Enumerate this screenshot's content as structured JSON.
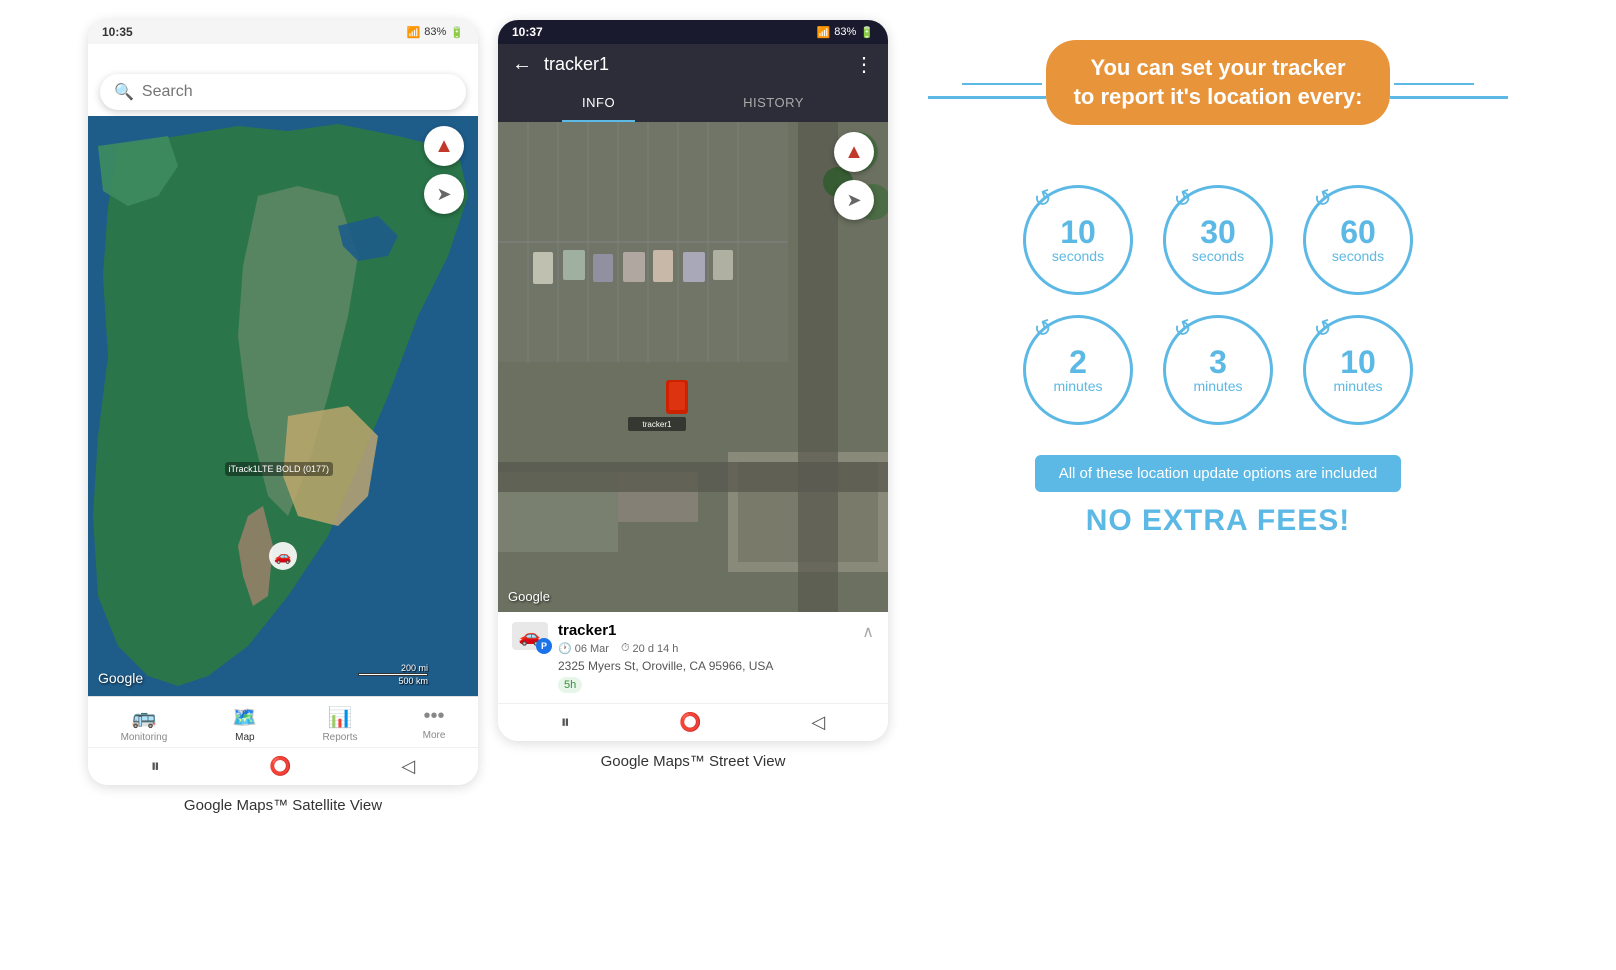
{
  "phone1": {
    "status": {
      "time": "10:35",
      "signal": "▲▲▲",
      "battery": "83%"
    },
    "search": {
      "placeholder": "Search"
    },
    "map": {
      "label": "Google",
      "scale_200mi": "200 mi",
      "scale_500km": "500 km",
      "tracker_label": "iTrack1LTE BOLD (0177)"
    },
    "nav": {
      "items": [
        {
          "icon": "🚌",
          "label": "Monitoring",
          "active": false
        },
        {
          "icon": "🗺",
          "label": "Map",
          "active": true
        },
        {
          "icon": "📊",
          "label": "Reports",
          "active": false
        },
        {
          "icon": "•••",
          "label": "More",
          "active": false
        }
      ]
    },
    "caption": "Google Maps™ Satellite View"
  },
  "phone2": {
    "status": {
      "time": "10:37",
      "signal": "▲▲▲",
      "battery": "83%"
    },
    "header": {
      "title": "tracker1",
      "back_label": "←",
      "more_label": "⋮"
    },
    "tabs": [
      {
        "label": "INFO",
        "active": true
      },
      {
        "label": "HISTORY",
        "active": false
      }
    ],
    "map": {
      "google_label": "Google",
      "tracker_label": "tracker1"
    },
    "tracker_info": {
      "name": "tracker1",
      "date": "06 Mar",
      "duration": "20 d 14 h",
      "address": "2325 Myers St, Oroville, CA 95966, USA",
      "time_badge": "5h"
    },
    "caption": "Google Maps™ Street View"
  },
  "infographic": {
    "title": "You can set your tracker\nto report it's location every:",
    "circles": [
      {
        "number": "10",
        "unit": "seconds"
      },
      {
        "number": "30",
        "unit": "seconds"
      },
      {
        "number": "60",
        "unit": "seconds"
      },
      {
        "number": "2",
        "unit": "minutes"
      },
      {
        "number": "3",
        "unit": "minutes"
      },
      {
        "number": "10",
        "unit": "minutes"
      }
    ],
    "included_text": "All of these location update options are included",
    "no_fees_text": "NO EXTRA FEES!",
    "accent_color": "#e8943a",
    "blue_color": "#5cb8e4"
  }
}
